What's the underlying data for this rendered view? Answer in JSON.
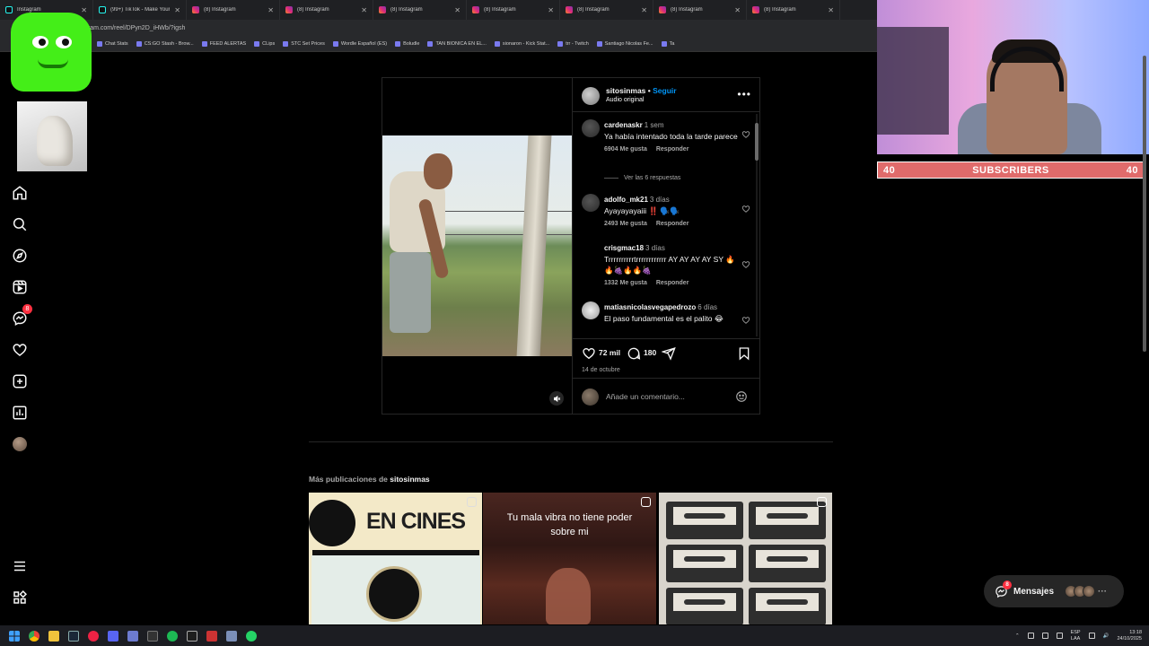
{
  "browser": {
    "tabs": [
      {
        "label": "Instagram",
        "kind": "tiktok"
      },
      {
        "label": "(99+) TikTok - Make Your Day",
        "kind": "tiktok"
      },
      {
        "label": "(8) Instagram",
        "kind": "instagram"
      },
      {
        "label": "(8) Instagram",
        "kind": "instagram"
      },
      {
        "label": "(8) Instagram",
        "kind": "instagram"
      },
      {
        "label": "(8) Instagram",
        "kind": "instagram"
      },
      {
        "label": "(8) Instagram",
        "kind": "instagram"
      },
      {
        "label": "(8) Instagram",
        "kind": "instagram"
      },
      {
        "label": "(8) Instagram",
        "kind": "instagram"
      }
    ],
    "url": "gram.com/reel/DPyn2D_iHWb/?igsh",
    "bookmarks": [
      "Chat Stats",
      "CS:GO Stash - Brow...",
      "FEED ALERTAS",
      "CLips",
      "STC Set Prices",
      "Wordle Español (ES)",
      "Boludle",
      "TAN BIONICA EN EL...",
      "sionaron - Kick Stat...",
      "trr - Twitch",
      "Santiago Nicolas Fe...",
      "Ta"
    ]
  },
  "stream": {
    "subs_left": "40",
    "subs_label": "SUBSCRIBERS",
    "subs_right": "40"
  },
  "nav": {
    "notifications_badge": "8"
  },
  "post": {
    "username": "sitosinmas",
    "dot": "•",
    "follow": "Seguir",
    "audio": "Audio original",
    "comments": [
      {
        "user": "cardenaskr",
        "time": "1 sem",
        "text": "Ya había intentado toda la tarde parece",
        "likes": "6904 Me gusta",
        "reply": "Responder"
      },
      {
        "user": "adolfo_mk21",
        "time": "3 días",
        "text": "Ayayayayaiii ‼️ 🗣️🗣️",
        "likes": "2493 Me gusta",
        "reply": "Responder"
      },
      {
        "user": "crisgmac18",
        "time": "3 días",
        "text": "Trrrrrrrrrrtrrrrrrrrrrrr AY AY AY AY SY 🔥🔥🍇🔥🔥🍇",
        "likes": "1332 Me gusta",
        "reply": "Responder"
      },
      {
        "user": "matiasnicolasvegapedrozo",
        "time": "6 días",
        "text": "El paso fundamental es el palito 😂",
        "likes": "",
        "reply": ""
      }
    ],
    "view_replies": "Ver las 6 respuestas",
    "like_count": "72 mil",
    "comment_count": "180",
    "date": "14 de octubre",
    "add_comment_placeholder": "Añade un comentario..."
  },
  "more": {
    "prefix": "Más publicaciones de",
    "user": "sitosinmas",
    "grid": [
      {
        "caption": "EN CINES"
      },
      {
        "caption": "Tu mala vibra no tiene poder sobre mi"
      },
      {
        "caption": ""
      }
    ]
  },
  "messages": {
    "label": "Mensajes",
    "badge": "8",
    "dots": "···"
  },
  "taskbar": {
    "lang_top": "ESP",
    "lang_bottom": "LAA",
    "time": "13:18",
    "date": "24/10/2025"
  },
  "colors": {
    "accent": "#0095f6",
    "badge": "#ff3040",
    "subs_bar": "#e06b6b",
    "mascot": "#44ee18"
  }
}
